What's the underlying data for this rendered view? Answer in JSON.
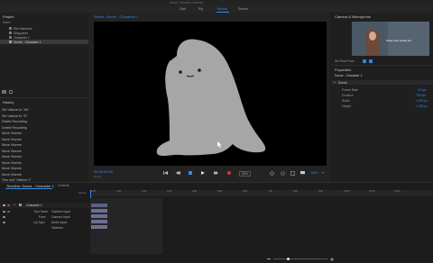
{
  "app": {
    "title": "Adobe Character Animator",
    "workspace_tabs": [
      "Start",
      "Rig",
      "Record",
      "Stream"
    ],
    "active_tab": "Record"
  },
  "project": {
    "title": "Project",
    "column_name": "Name",
    "items": [
      "Eho Interview",
      "Sling anim",
      "Character 1",
      "Scene - Character 1"
    ]
  },
  "history": {
    "title": "History",
    "items": [
      "Set Viseme to \"Ah\"",
      "Set Viseme to \"D\"",
      "Delete Recording",
      "Delete Recording",
      "Move Viseme",
      "Move Viseme",
      "Move Viseme",
      "Move Viseme",
      "Move Viseme",
      "Move Viseme",
      "Move Viseme",
      "Move Viseme",
      "Trim end \"Viseme 1\""
    ]
  },
  "scene": {
    "title": "Scene: Scene - Character 1",
    "timecode": "00:00:00:00",
    "fps": "24 fps",
    "zoom": "100%",
    "level": "11%"
  },
  "camera": {
    "title": "Camera & Microphone",
    "caption": "Stream cam overlay text",
    "set_rest_pose": "Set Rest Pose"
  },
  "properties": {
    "title": "Properties",
    "subject": "Scene - Character 1",
    "section": "Scene",
    "rows": [
      {
        "label": "Frame Rate",
        "value": "24 fps"
      },
      {
        "label": "Duration",
        "value": "750 fps"
      },
      {
        "label": "Width",
        "value": "1,920 px"
      },
      {
        "label": "Height",
        "value": "1,080 px"
      }
    ]
  },
  "timeline": {
    "title": "Timeline: Scene - Character 1",
    "tab2": "Controls",
    "row_label": "Scene",
    "track_name": "Character 1",
    "subtracks": [
      {
        "name": "Eye Gaze",
        "input": "Camera Input"
      },
      {
        "name": "Face",
        "input": "Camera Input"
      },
      {
        "name": "Lip Sync",
        "input": "Audio Input"
      },
      {
        "name": "",
        "input": "Visemes"
      }
    ],
    "ticks": [
      "0:00",
      "1:00",
      "2:00",
      "3:00",
      "4:00",
      "5:00",
      "6:00",
      "7:00",
      "8:00",
      "9:00",
      "10:00",
      "11:00",
      "12:00"
    ]
  },
  "colors": {
    "accent": "#2d8ceb",
    "panel_bg": "#1d1d1d",
    "canvas_bg": "#000000",
    "character": "#a6a6a6",
    "record": "#d23c3c",
    "clip": "#6a6f91"
  }
}
